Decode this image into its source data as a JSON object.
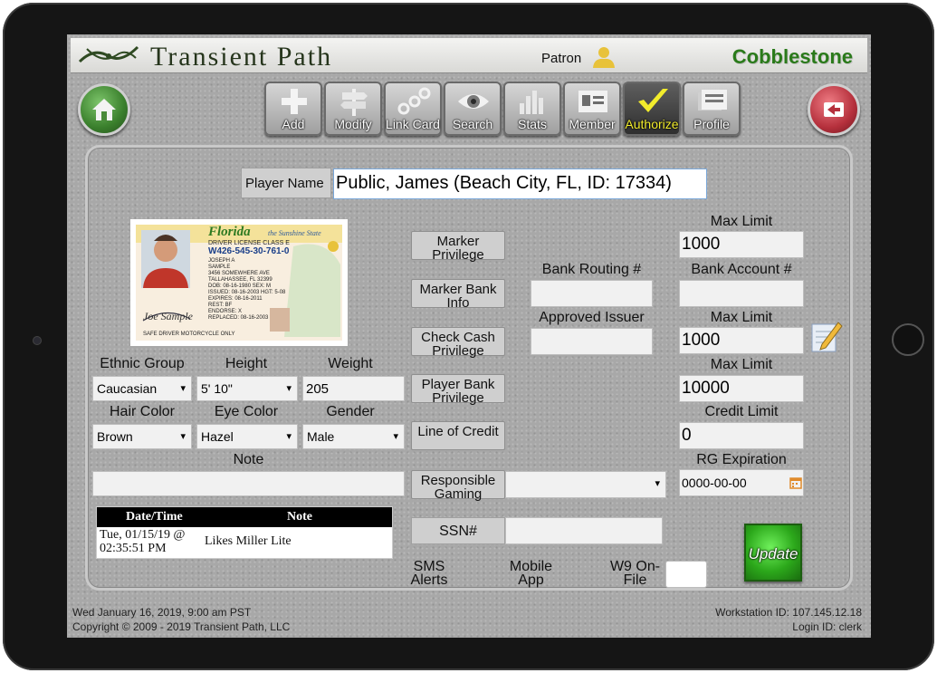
{
  "header": {
    "brand": "Transient Path",
    "patron_label": "Patron",
    "venue": "Cobblestone"
  },
  "toolbar": {
    "items": [
      {
        "label": "Add",
        "icon": "plus-icon"
      },
      {
        "label": "Modify",
        "icon": "signpost-icon"
      },
      {
        "label": "Link Card",
        "icon": "link-card-icon"
      },
      {
        "label": "Search",
        "icon": "eye-icon"
      },
      {
        "label": "Stats",
        "icon": "bar-chart-icon"
      },
      {
        "label": "Member",
        "icon": "member-card-icon"
      },
      {
        "label": "Authorize",
        "icon": "checkmark-icon",
        "active": true
      },
      {
        "label": "Profile",
        "icon": "profile-icon"
      }
    ]
  },
  "player": {
    "name_label": "Player Name",
    "name_value": "Public, James (Beach City, FL, ID: 17334)"
  },
  "license": {
    "state": "Florida",
    "tagline": "the Sunshine State",
    "type": "DRIVER LICENSE CLASS E",
    "number": "W426-545-30-761-0",
    "name_line1": "JOSEPH A",
    "name_line2": "SAMPLE",
    "address1": "3456 SOMEWHERE AVE",
    "address2": "TALLAHASSEE, FL 32399",
    "dob": "DOB: 08-16-1980  SEX: M",
    "issued": "ISSUED: 08-16-2003  HGT: 5-08",
    "expires": "EXPIRES: 08-16-2011",
    "rest": "REST: BF",
    "endorse": "ENDORSE: X",
    "replaced": "REPLACED: 08-16-2003",
    "signature": "Joe Sample",
    "footer": "SAFE DRIVER    MOTORCYCLE ONLY"
  },
  "physical": {
    "ethnic_label": "Ethnic Group",
    "ethnic_value": "Caucasian",
    "height_label": "Height",
    "height_value": "5' 10\"",
    "weight_label": "Weight",
    "weight_value": "205",
    "hair_label": "Hair Color",
    "hair_value": "Brown",
    "eye_label": "Eye Color",
    "eye_value": "Hazel",
    "gender_label": "Gender",
    "gender_value": "Male",
    "note_label": "Note",
    "note_value": ""
  },
  "notes_table": {
    "col_datetime": "Date/Time",
    "col_note": "Note",
    "rows": [
      {
        "datetime": "Tue, 01/15/19 @ 02:35:51 PM",
        "note": "Likes Miller Lite"
      }
    ]
  },
  "privileges": {
    "marker_privilege": "Marker Privilege",
    "marker_bank_info": "Marker Bank Info",
    "check_cash_privilege": "Check Cash Privilege",
    "player_bank_privilege": "Player Bank Privilege",
    "line_of_credit": "Line of Credit",
    "responsible_gaming": "Responsible Gaming",
    "responsible_gaming_value": "",
    "ssn_label": "SSN#",
    "ssn_value": "",
    "sms_alerts": "SMS Alerts",
    "mobile_app": "Mobile App",
    "w9_label": "W9 On-File"
  },
  "fields": {
    "max_limit_label": "Max Limit",
    "marker_max_limit": "1000",
    "bank_routing_label": "Bank Routing #",
    "bank_routing_value": "",
    "bank_account_label": "Bank Account #",
    "bank_account_value": "",
    "approved_issuer_label": "Approved Issuer",
    "approved_issuer_value": "",
    "check_max_limit": "1000",
    "player_bank_max_limit": "10000",
    "credit_limit_label": "Credit Limit",
    "credit_limit_value": "0",
    "rg_expiration_label": "RG Expiration",
    "rg_expiration_value": "0000-00-00"
  },
  "update_label": "Update",
  "footer": {
    "datetime": "Wed January 16, 2019, 9:00 am PST",
    "copyright": "Copyright © 2009 - 2019 Transient Path, LLC",
    "workstation": "Workstation ID: 107.145.12.18",
    "login": "Login ID: clerk"
  },
  "colors": {
    "venue_green": "#2a7a1a",
    "authorize_yellow": "#f2ec2c",
    "update_green": "#2ca81b",
    "back_red": "#b5303c",
    "home_green": "#3a7f2c"
  }
}
